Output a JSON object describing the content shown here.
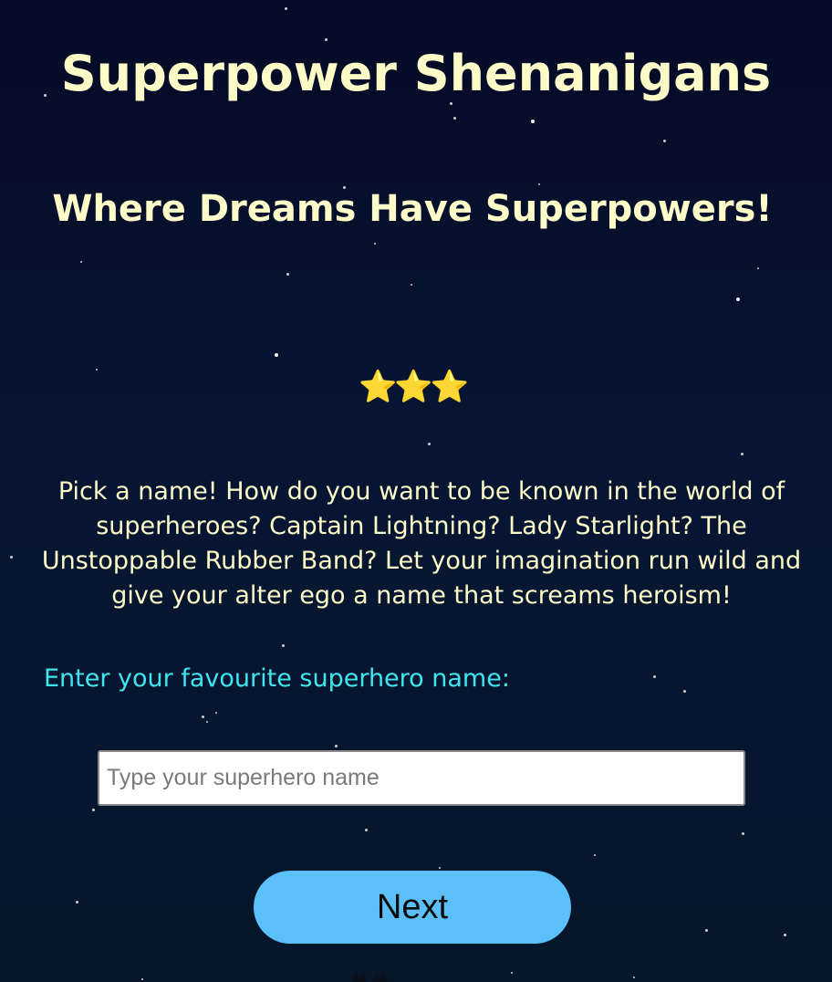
{
  "page": {
    "title": "Superpower Shenanigans",
    "subtitle": "Where Dreams Have Superpowers!",
    "rating_icons": "⭐⭐⭐",
    "rating": 3,
    "rating_max": 3,
    "description": "Pick a name! How do you want to be known in the world of superheroes? Captain Lightning? Lady Starlight? The Unstoppable Rubber Band? Let your imagination run wild and give your alter ego a name that screams heroism!"
  },
  "form": {
    "label": "Enter your favourite superhero name:",
    "input_value": "",
    "input_placeholder": "Type your superhero name",
    "next_label": "Next"
  },
  "colors": {
    "background": "#061030",
    "heading_text": "#fdfbc8",
    "label_text": "#3fe6f0",
    "button_bg": "#5bc0f8",
    "input_bg": "#ffffff"
  },
  "icons": {
    "rating": "star-icon",
    "bottom": "silhouette-icon"
  }
}
